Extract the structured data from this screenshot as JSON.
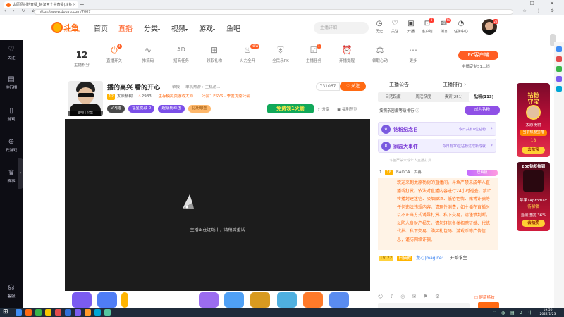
{
  "browser": {
    "tab_title": "太原杨树的直播_好汉两个半直播|斗鱼",
    "tab_close": "×",
    "new_tab": "+",
    "url": "https://www.douyu.com/7007",
    "window_controls": "— ☐ ✕",
    "nav_glyphs": "‹ › ↻ ⌂",
    "tool_glyphs": "☆ ⋮ ⚙"
  },
  "header": {
    "logo_text": "斗鱼",
    "logo_sub": "DOUYU.COM",
    "nav": {
      "home": "首页",
      "live": "直播",
      "category": "分类",
      "video": "视频",
      "game": "游戏",
      "yuba": "鱼吧"
    },
    "dropdown_glyph": "▾",
    "search_placeholder": "主播详细",
    "icons": [
      {
        "label": "历史",
        "glyph": "◷",
        "badge": ""
      },
      {
        "label": "关注",
        "glyph": "♡",
        "badge": ""
      },
      {
        "label": "开播",
        "glyph": "▣",
        "badge": ""
      },
      {
        "label": "客户端",
        "glyph": "⊡",
        "badge": "8"
      },
      {
        "label": "消息",
        "glyph": "✉",
        "badge": "68"
      },
      {
        "label": "任务中心",
        "glyph": "◔",
        "badge": ""
      }
    ],
    "avatar_badge": "28"
  },
  "sidebar": {
    "items": [
      {
        "label": "关注",
        "glyph": "♡"
      },
      {
        "label": "排行榜",
        "glyph": "▤"
      },
      {
        "label": "游戏",
        "glyph": "▯"
      },
      {
        "label": "云游戏",
        "glyph": "⊕"
      },
      {
        "label": "赛事",
        "glyph": "♛"
      },
      {
        "label": "客服",
        "glyph": "☊"
      }
    ],
    "collapse_glyph": "›"
  },
  "toolbar": {
    "score": {
      "value": "12",
      "label": "主播积分"
    },
    "items": [
      {
        "label": "直播开关",
        "glyph": "⏻",
        "badge": "4"
      },
      {
        "label": "推流码",
        "glyph": "∿",
        "badge": ""
      },
      {
        "label": "招商任务",
        "glyph": "AD",
        "badge": ""
      },
      {
        "label": "领取礼物",
        "glyph": "⊞",
        "badge": ""
      },
      {
        "label": "火力全开",
        "glyph": "♨",
        "badge": "NEW"
      },
      {
        "label": "全民乐PK",
        "glyph": "⛨",
        "badge": ""
      },
      {
        "label": "主播任务",
        "glyph": "☑",
        "badge": "1"
      },
      {
        "label": "开播提醒",
        "glyph": "⏰",
        "badge": ""
      },
      {
        "label": "领取心动",
        "glyph": "⚖",
        "badge": ""
      },
      {
        "label": "更多",
        "glyph": "⋯",
        "badge": ""
      }
    ],
    "pc_button": "PC客户端",
    "pc_sub": "主播定制51上线"
  },
  "room": {
    "title": "播的高兴 看的开心",
    "report": "举报",
    "category": "单机热游 › 主机游...",
    "level": "12",
    "streamer_name": "太原杨树",
    "hot_value": "2983",
    "achievement": "生存模拟类游戏大师",
    "guild": "公会：ESVS · 季度优秀公会",
    "avatar_caption": "鱼吧 | 公告",
    "pills": [
      {
        "label": "V闪耀",
        "color": "#4a4a4a"
      },
      {
        "label": "福星挑战  0",
        "color": "#7b4fe8"
      },
      {
        "label": "超级粉丝团",
        "color": "#7b4fe8"
      },
      {
        "label": "钻粉联盟",
        "color": "#ffb86b"
      }
    ],
    "fans_count": "731067",
    "follow_label": "♡ 关注",
    "free_gift": "免费领1火箭",
    "share": "⇪ 分享",
    "welfare": "▣ 福利签到"
  },
  "player": {
    "message": "主播正在连线中，请稍后重试"
  },
  "gifts": [
    {
      "color": "#7b5cf0"
    },
    {
      "color": "#4f7df5"
    },
    {
      "color": "#ffb400"
    },
    {
      "color": "#9b6cf0"
    },
    {
      "color": "#4fa0f5"
    },
    {
      "color": "#d89a20"
    },
    {
      "color": "#4fb0e0"
    },
    {
      "color": "#ff7a2a"
    },
    {
      "color": "#5a8cf0"
    }
  ],
  "chat": {
    "header_title": "主播公告",
    "header_right": "主播排行 ›",
    "rank_tabs": [
      {
        "label": "日活跃度"
      },
      {
        "label": "周活跃度"
      },
      {
        "label": "贵宾(251)"
      },
      {
        "label": "钻粉(113)"
      }
    ],
    "rank_note": "按照亲密度等级排行 ⓘ",
    "tiers_button": "成为钻粉",
    "cards": [
      {
        "icon": "♛",
        "title": "钻粉纪念日",
        "desc": "今日共有8位钻粉",
        "chev": "›"
      },
      {
        "icon": "♜",
        "title": "家园大事件",
        "desc": "今日有20位钻粉达成新成就",
        "chev": "›"
      }
    ],
    "fade_message": "斗鱼严禁未成年人直播打赏",
    "user_line": {
      "num": "1",
      "level": "18",
      "name": "BAODA · 古再",
      "vip": "已解锁"
    },
    "notice": "欢迎来到太原杨树的直播间。斗鱼严禁未成年人直播或打赏。依法对直播内容进行24小时巡查。禁止传播封建迷信、吸烟酗酒、低俗色情、赌博诈骗等任何违法违规内容。请理性消费，如主播在直播时以不正当方式诱导打赏、私下交易，请谨慎判断，以防人身财产损失。请勿轻信各类招聘征婚、代练代抽、私下交易、购买礼包码、游戏币等广告信息，谨防网络诈骗。",
    "chat_line": {
      "level": "LV 22",
      "badge": "白猫教",
      "name": "龙心|magine:",
      "msg": "开始求生"
    },
    "input_icons": "☺ ♪ ◎ ✉ ⚑ ⚙",
    "barrage_toggle": "☐ 屏蔽特效"
  },
  "right_banners": {
    "b1": {
      "title1": "钻粉",
      "title2": "守宝",
      "name": "太原杨树",
      "label": "当前热度宝箱",
      "score": "18",
      "button": "去抢宝"
    },
    "b2": {
      "title": "200钻粉抽到",
      "t1": "苹果14promax",
      "t2": "待解锁",
      "t3": "当前进度 36%",
      "button": "去抽奖"
    }
  },
  "taskbar": {
    "time": "19:50",
    "date": "2022/1/23",
    "tray_glyphs": "˄ ◍ ▤ ♪ 中",
    "icons": [
      {
        "color": "#3f8ef5"
      },
      {
        "color": "#ff6a13"
      },
      {
        "color": "#39b54a"
      },
      {
        "color": "#f7c800"
      },
      {
        "color": "#e34c4c"
      },
      {
        "color": "#2f6fd8"
      },
      {
        "color": "#7a5cf0"
      },
      {
        "color": "#ff9a2a"
      },
      {
        "color": "#00a6d6"
      },
      {
        "color": "#55c7a0"
      }
    ]
  }
}
